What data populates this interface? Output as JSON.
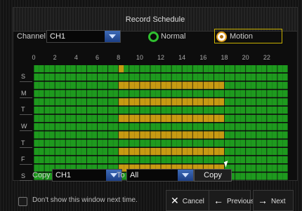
{
  "dialog": {
    "title": "Record Schedule"
  },
  "channel": {
    "label": "Channel",
    "value": "CH1"
  },
  "modes": {
    "normal_label": "Normal",
    "motion_label": "Motion",
    "selected": "Motion"
  },
  "hour_labels": [
    "0",
    "2",
    "4",
    "6",
    "8",
    "10",
    "12",
    "14",
    "16",
    "18",
    "20",
    "22"
  ],
  "days": [
    "S",
    "M",
    "T",
    "W",
    "T",
    "F",
    "S"
  ],
  "colors": {
    "normal": "#1e9a1e",
    "motion": "#c79a12",
    "grid": "#0a0a0a"
  },
  "schedule": [
    {
      "day": "S",
      "motion_start": 8,
      "motion_end": 8.5
    },
    {
      "day": "S",
      "motion_start": null,
      "motion_end": null
    },
    {
      "day": "M",
      "motion_start": 8,
      "motion_end": 18
    },
    {
      "day": "M",
      "motion_start": null,
      "motion_end": null
    },
    {
      "day": "T",
      "motion_start": 8,
      "motion_end": 18
    },
    {
      "day": "T",
      "motion_start": null,
      "motion_end": null
    },
    {
      "day": "W",
      "motion_start": 8,
      "motion_end": 18
    },
    {
      "day": "W",
      "motion_start": null,
      "motion_end": null
    },
    {
      "day": "T",
      "motion_start": 8,
      "motion_end": 18
    },
    {
      "day": "T",
      "motion_start": null,
      "motion_end": null
    },
    {
      "day": "F",
      "motion_start": 8,
      "motion_end": 18
    },
    {
      "day": "F",
      "motion_start": null,
      "motion_end": null
    },
    {
      "day": "S",
      "motion_start": 8,
      "motion_end": 18
    },
    {
      "day": "S",
      "motion_start": null,
      "motion_end": null
    }
  ],
  "copy": {
    "label": "Copy",
    "from_value": "CH1",
    "to_label": "To",
    "to_value": "All",
    "button_label": "Copy"
  },
  "footer": {
    "checkbox_label": "Don't show this window next time.",
    "cancel_label": "Cancel",
    "previous_label": "Previous",
    "next_label": "Next"
  }
}
